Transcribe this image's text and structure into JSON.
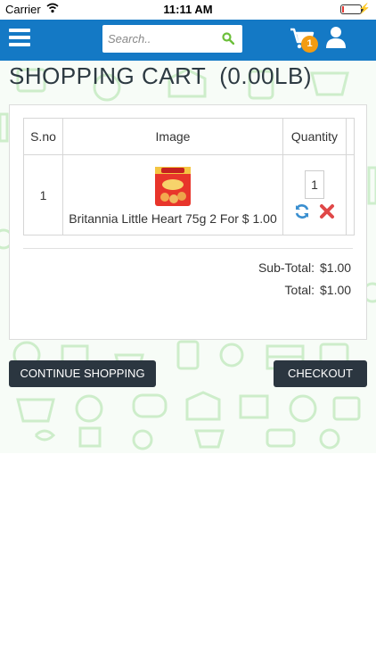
{
  "status_bar": {
    "carrier": "Carrier",
    "time": "11:11 AM"
  },
  "header": {
    "search_placeholder": "Search..",
    "cart_count": "1"
  },
  "page_title": "SHOPPING CART  (0.00LB)",
  "table": {
    "headers": [
      "S.no",
      "Image",
      "Quantity"
    ],
    "rows": [
      {
        "sno": "1",
        "product_name": "Britannia Little Heart 75g 2 For $ 1.00",
        "quantity": "1"
      }
    ]
  },
  "totals": {
    "subtotal_label": "Sub-Total:",
    "subtotal_value": "$1.00",
    "total_label": "Total:",
    "total_value": "$1.00"
  },
  "buttons": {
    "continue": "CONTINUE SHOPPING",
    "checkout": "CHECKOUT"
  },
  "colors": {
    "header_bg": "#1479c5",
    "badge": "#f39c12",
    "button_bg": "#2b3640",
    "pattern": "#c9ecc6"
  },
  "icons": [
    "wifi-icon",
    "battery-icon",
    "menu-icon",
    "search-icon",
    "cart-icon",
    "user-icon",
    "refresh-icon",
    "remove-icon"
  ]
}
